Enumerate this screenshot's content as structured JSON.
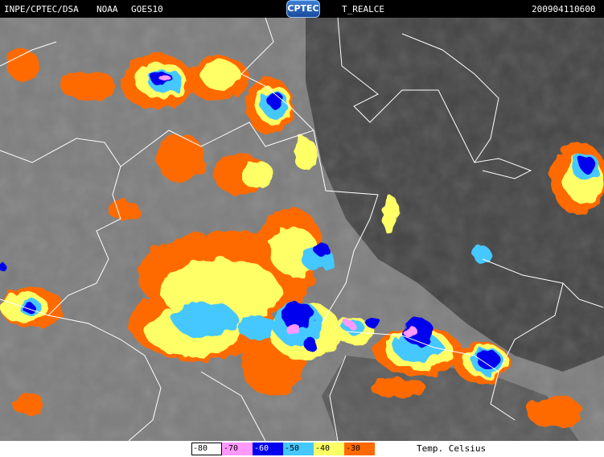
{
  "header": {
    "source": "INPE/CPTEC/DSA",
    "satellite_agency": "NOAA",
    "satellite": "GOES10",
    "logo_text": "CPTEC",
    "product": "T_REALCE",
    "timestamp": "200904110600"
  },
  "legend": {
    "items": [
      {
        "label": "-80",
        "color": "#ff9ff0"
      },
      {
        "label": "-70",
        "color": "#ff99ff"
      },
      {
        "label": "-60",
        "color": "#0000ee"
      },
      {
        "label": "-50",
        "color": "#44c8ff"
      },
      {
        "label": "-40",
        "color": "#ffff66"
      },
      {
        "label": "-30",
        "color": "#ff6a00"
      }
    ],
    "unit_label": "Temp. Celsius"
  },
  "colors": {
    "background": "#000000",
    "cloud_field": "#7a7a7a",
    "dark_area": "#3a3a3a",
    "borders": "#ffffff"
  }
}
